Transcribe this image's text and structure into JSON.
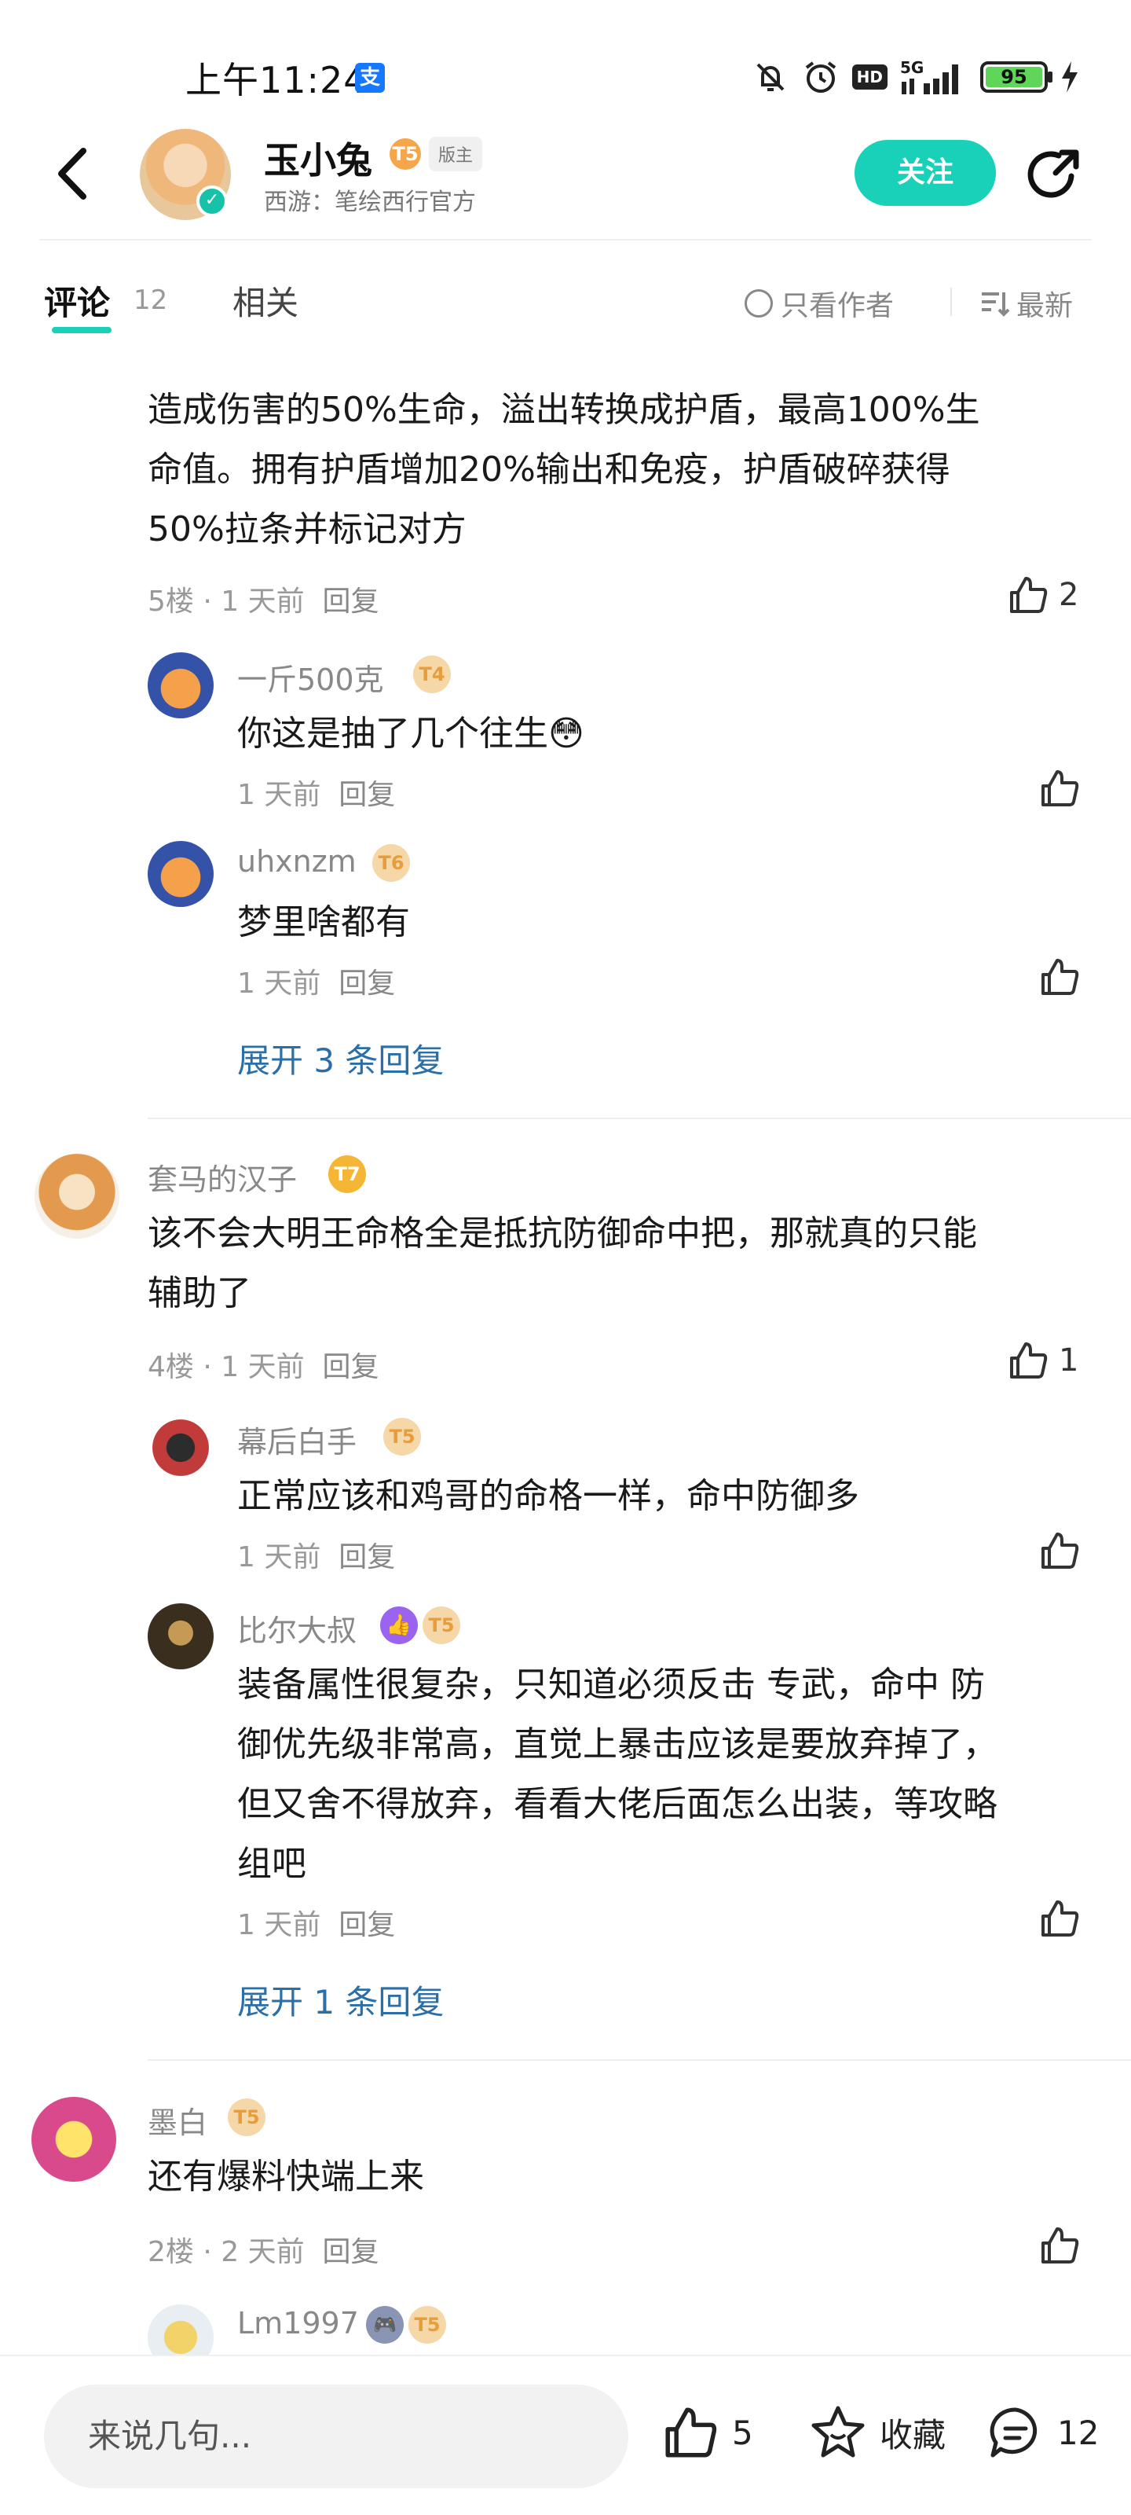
{
  "status_bar": {
    "time": "上午11:24",
    "alipay_label": "支",
    "hd_label": "HD",
    "network": "5G",
    "battery": "95"
  },
  "header": {
    "author_name": "玉小兔",
    "author_level": "T5",
    "role_badge": "版主",
    "subtitle": "西游：笔绘西行官方",
    "follow_label": "关注"
  },
  "tabs": {
    "comments_label": "评论",
    "comments_count": "12",
    "related_label": "相关",
    "author_only_label": "只看作者",
    "sort_label": "最新"
  },
  "comments": [
    {
      "text_line1": "造成伤害的50%生命，溢出转换成护盾，最高100%生",
      "text_line2": "命值。拥有护盾增加20%输出和免疫，护盾破碎获得",
      "text_line3": "50%拉条并标记对方",
      "floor": "5楼",
      "time": "1 天前",
      "reply_label": "回复",
      "likes": "2",
      "replies": [
        {
          "user": "一斤500克",
          "level": "T4",
          "text": "你这是抽了几个往生😳",
          "time": "1 天前",
          "reply_label": "回复"
        },
        {
          "user": "uhxnzm",
          "level": "T6",
          "text": "梦里啥都有",
          "time": "1 天前",
          "reply_label": "回复"
        }
      ],
      "expand_label": "展开 3 条回复"
    },
    {
      "user": "套马的汉子",
      "level": "T7",
      "text_line1": "该不会大明王命格全是抵抗防御命中把，那就真的只能",
      "text_line2": "辅助了",
      "floor": "4楼",
      "time": "1 天前",
      "reply_label": "回复",
      "likes": "1",
      "replies": [
        {
          "user": "幕后白手",
          "level": "T5",
          "text": "正常应该和鸡哥的命格一样，命中防御多",
          "time": "1 天前",
          "reply_label": "回复"
        },
        {
          "user": "比尔大叔",
          "level": "T5",
          "text_line1": "装备属性很复杂，只知道必须反击 专武，命中 防",
          "text_line2": "御优先级非常高，直觉上暴击应该是要放弃掉了，",
          "text_line3": "但又舍不得放弃，看看大佬后面怎么出装，等攻略",
          "text_line4": "组吧",
          "time": "1 天前",
          "reply_label": "回复"
        }
      ],
      "expand_label": "展开 1 条回复"
    },
    {
      "user": "墨白",
      "level": "T5",
      "text": "还有爆料快端上来",
      "floor": "2楼",
      "time": "2 天前",
      "reply_label": "回复",
      "replies": [
        {
          "user": "Lm1997",
          "level": "T5"
        }
      ]
    }
  ],
  "bottom_bar": {
    "input_placeholder": "来说几句...",
    "like_count": "5",
    "favorite_label": "收藏",
    "comment_count": "12"
  },
  "colors": {
    "accent": "#18d1b8",
    "link": "#2a6fa8",
    "meta": "#999999"
  }
}
